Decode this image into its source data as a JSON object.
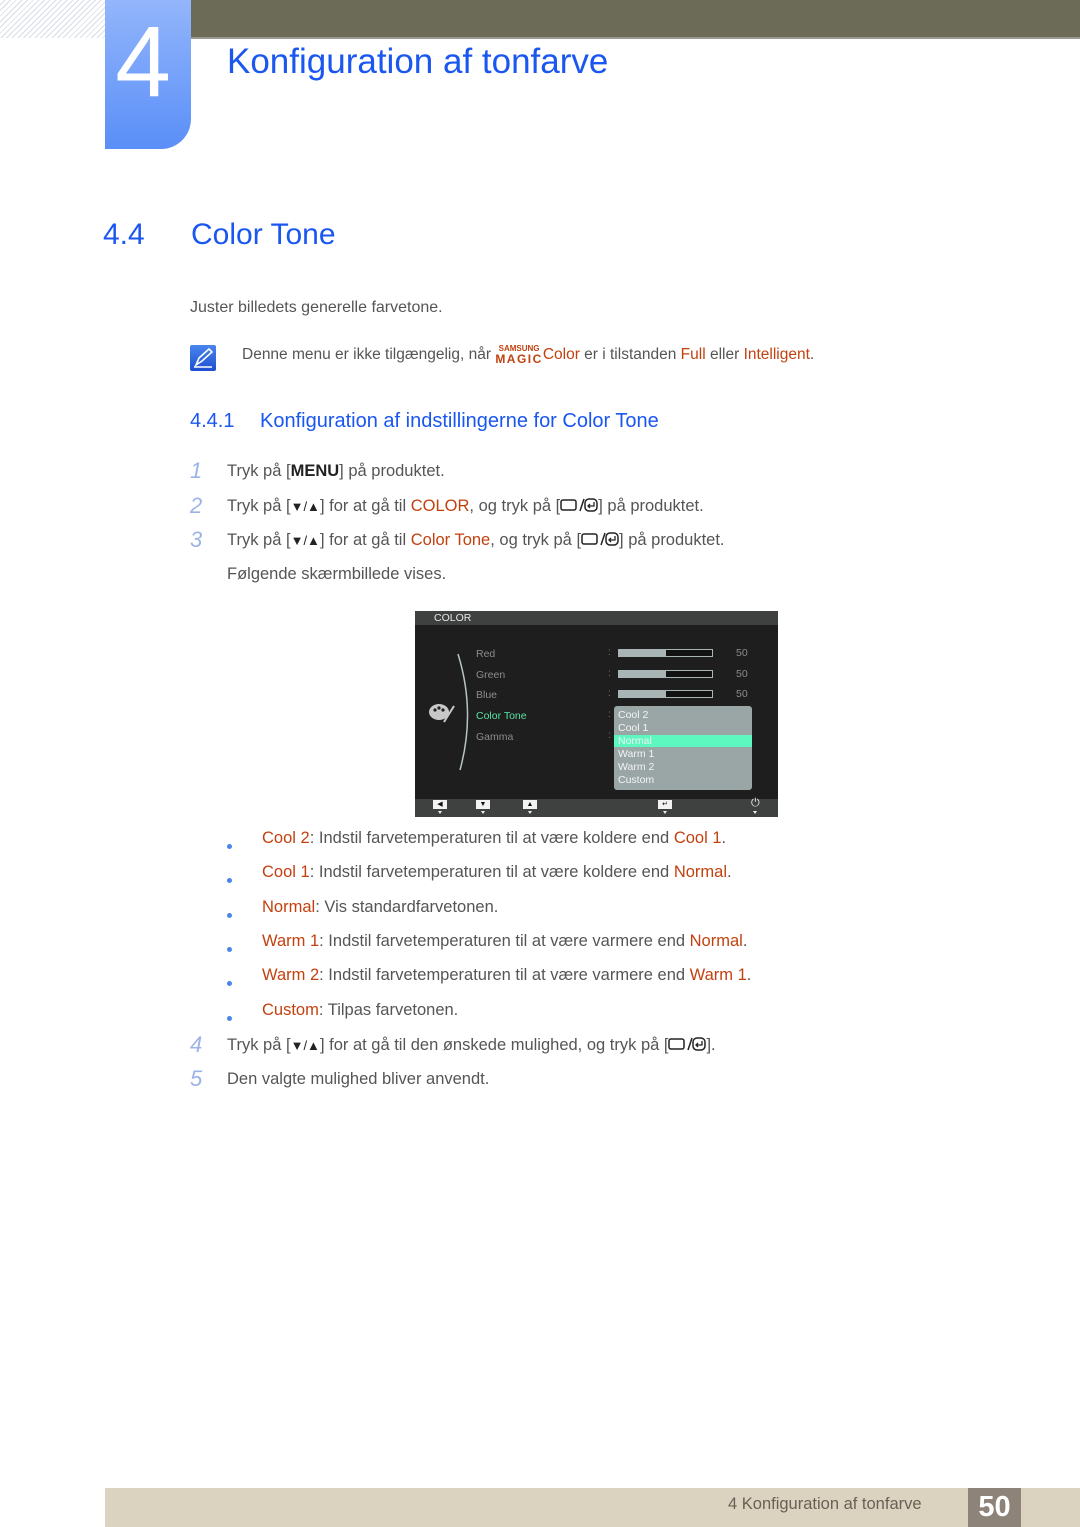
{
  "header": {
    "chapter_number": "4",
    "chapter_title": "Konfiguration af tonfarve"
  },
  "section": {
    "number": "4.4",
    "title": "Color Tone",
    "intro": "Juster billedets generelle farvetone.",
    "note": {
      "icon": "note-pencil-icon",
      "before": "Denne menu er ikke tilgængelig, når ",
      "brand_top": "SAMSUNG",
      "brand_bottom": "MAGIC",
      "brand_word": "Color",
      "middle": " er i tilstanden ",
      "opt1": "Full",
      "between": " eller ",
      "opt2": "Intelligent",
      "end": "."
    }
  },
  "subsection": {
    "number": "4.4.1",
    "title": "Konfiguration af indstillingerne for Color Tone"
  },
  "steps": [
    {
      "n": "1",
      "a": "Tryk på [",
      "key": "MENU",
      "b": "] på produktet."
    },
    {
      "n": "2",
      "a": "Tryk på [",
      "arrows": "▼/▲",
      "b": "] for at gå til ",
      "hl": "COLOR",
      "c": ", og tryk på [",
      "d": "] på produktet."
    },
    {
      "n": "3",
      "a": "Tryk på [",
      "arrows": "▼/▲",
      "b": "] for at gå til ",
      "hl": "Color Tone",
      "c": ", og tryk på [",
      "d": "] på produktet.",
      "after": "Følgende skærmbillede vises."
    },
    {
      "n": "4",
      "a": "Tryk på [",
      "arrows": "▼/▲",
      "b": "] for at gå til den ønskede mulighed, og tryk på [",
      "d": "]."
    },
    {
      "n": "5",
      "a": "Den valgte mulighed bliver anvendt."
    }
  ],
  "osd": {
    "title": "COLOR",
    "items": [
      {
        "label": "Red",
        "value": "50",
        "fraction": 0.5
      },
      {
        "label": "Green",
        "value": "50",
        "fraction": 0.5
      },
      {
        "label": "Blue",
        "value": "50",
        "fraction": 0.5
      },
      {
        "label": "Color Tone",
        "active": true
      },
      {
        "label": "Gamma"
      }
    ],
    "colon": ":",
    "dropdown_options": [
      "Cool 2",
      "Cool 1",
      "Normal",
      "Warm 1",
      "Warm 2",
      "Custom"
    ],
    "selected_option": "Normal",
    "footer_buttons": [
      "◀",
      "▼",
      "▲",
      "↵",
      "⏻"
    ],
    "accent_color": "#58e3a5",
    "selected_color": "#5cf8c0"
  },
  "bullets": [
    {
      "term": "Cool 2",
      "text": ": Indstil farvetemperaturen til at være koldere end ",
      "ref": "Cool 1",
      "end": "."
    },
    {
      "term": "Cool 1",
      "text": ": Indstil farvetemperaturen til at være koldere end ",
      "ref": "Normal",
      "end": "."
    },
    {
      "term": "Normal",
      "text": ": Vis standardfarvetonen."
    },
    {
      "term": "Warm 1",
      "text": ": Indstil farvetemperaturen til at være varmere end ",
      "ref": "Normal",
      "end": "."
    },
    {
      "term": "Warm 2",
      "text": ": Indstil farvetemperaturen til at være varmere end ",
      "ref": "Warm 1",
      "end": "."
    },
    {
      "term": "Custom",
      "text": ": Tilpas farvetonen."
    }
  ],
  "footer": {
    "text": "4 Konfiguration af tonfarve",
    "page": "50"
  },
  "colors": {
    "heading_blue": "#1a56f0",
    "highlight_orange": "#c2410f",
    "top_bar": "#6c6b57",
    "footer_bg": "#dbd3bf",
    "page_box": "#8e8378"
  }
}
